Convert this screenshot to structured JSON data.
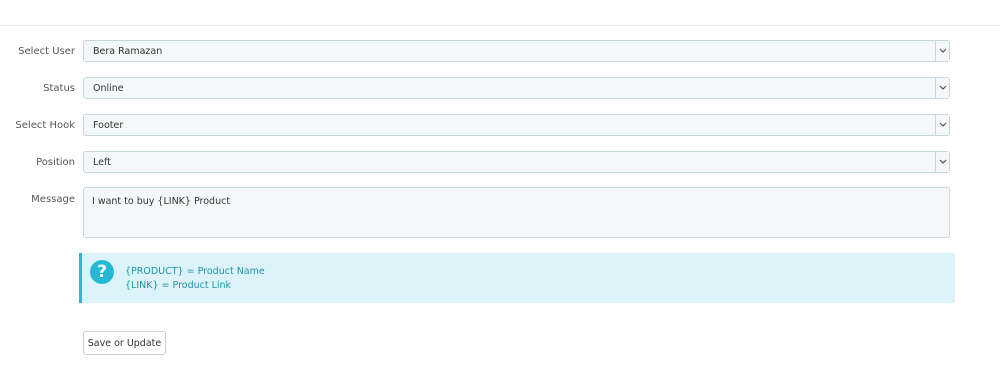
{
  "form": {
    "select_user": {
      "label": "Select User",
      "value": "Bera Ramazan"
    },
    "status": {
      "label": "Status",
      "value": "Online"
    },
    "select_hook": {
      "label": "Select Hook",
      "value": "Footer"
    },
    "position": {
      "label": "Position",
      "value": "Left"
    },
    "message": {
      "label": "Message",
      "value": "I want to buy {LINK} Product"
    }
  },
  "info": {
    "icon": "question-circle-icon",
    "line1": "{PRODUCT} = Product Name",
    "line2": "{LINK} = Product Link",
    "accent_color": "#25b9d7"
  },
  "actions": {
    "save_label": "Save or Update"
  }
}
